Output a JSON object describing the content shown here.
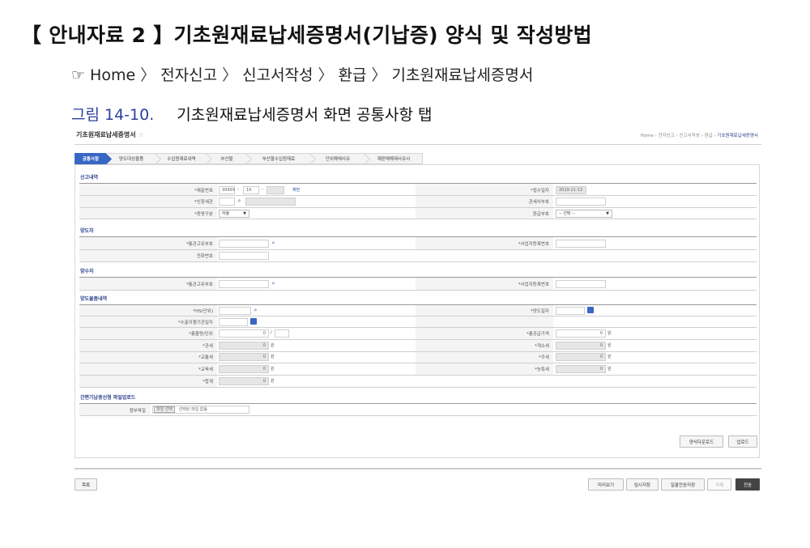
{
  "doc": {
    "title": "【 안내자료 2 】기초원재료납세증명서(기납증) 양식 및 작성방법",
    "breadcrumb_hand": "☞",
    "breadcrumb": [
      "Home",
      "전자신고",
      "신고서작성",
      "환급",
      "기초원재료납세증명서"
    ],
    "breadcrumb_sep": "〉",
    "figure_num": "그림 14-10.",
    "figure_caption": "기초원재료납세증명서 화면 공통사항 탭"
  },
  "screen": {
    "title": "기초원재료납세증명서",
    "star": "☆",
    "crumb": [
      "Home",
      "전자신고",
      "신고서작성",
      "환급"
    ],
    "crumb_current": "기초원재료납세증명서",
    "crumb_sep": "›",
    "tabs": [
      "공통사항",
      "양도대상물품",
      "수입원재료내역",
      "부산물",
      "부산물수입원재료",
      "단위해체사유",
      "재판매해제사유서"
    ],
    "sections": {
      "report": {
        "title": "신고내역",
        "doc_no_label": "*제출번호",
        "doc_no_value": "99999",
        "doc_no_sep": "-",
        "doc_no_year": "19",
        "doc_no_btn": "채번",
        "customs_label": "*신청세관",
        "type_label": "*증명구분",
        "type_value": "자율",
        "receipt_date_label": "*접수일자",
        "receipt_date_value": "2019-11-13",
        "customs_user_label": "관세사부호",
        "refund_label": "환급부호",
        "refund_value": "-- 선택 --"
      },
      "transferor": {
        "title": "양도자",
        "customs_code_label": "*통관고유부호",
        "phone_label": "전화번호",
        "biz_no_label": "*사업자등록번호"
      },
      "transferee": {
        "title": "양수자",
        "customs_code_label": "*통관고유부호",
        "biz_no_label": "*사업자등록번호"
      },
      "goods": {
        "title": "양도물품내역",
        "hs_label": "*HS(단위)",
        "date_label": "*수출이행기관일자",
        "qty_label": "*총물량/단위",
        "qty_value": "0",
        "qty_sep": "/",
        "transfer_date_label": "*양도일자",
        "supply_label": "*총공급가격",
        "supply_value": "0",
        "won": "원",
        "left_items": [
          {
            "label": "*관세",
            "value": "0"
          },
          {
            "label": "*교통세",
            "value": "0"
          },
          {
            "label": "*교육세",
            "value": "0"
          },
          {
            "label": "*합계",
            "value": "0"
          }
        ],
        "right_items": [
          {
            "label": "*개소세",
            "value": "0"
          },
          {
            "label": "*주세",
            "value": "0"
          },
          {
            "label": "*농특세",
            "value": "0"
          }
        ]
      },
      "upload": {
        "title": "간편기납증신청 파일업로드",
        "file_label": "첨부파일",
        "file_btn": "파일 선택",
        "file_text": "선택된 파일 없음"
      }
    },
    "panel_buttons": [
      "양식다운로드",
      "업로드"
    ],
    "bottom": {
      "list": "목록",
      "preview": "미리보기",
      "temp_save": "임시저장",
      "batch_save": "일괄전송저장",
      "delete": "삭제",
      "send": "전송"
    }
  }
}
